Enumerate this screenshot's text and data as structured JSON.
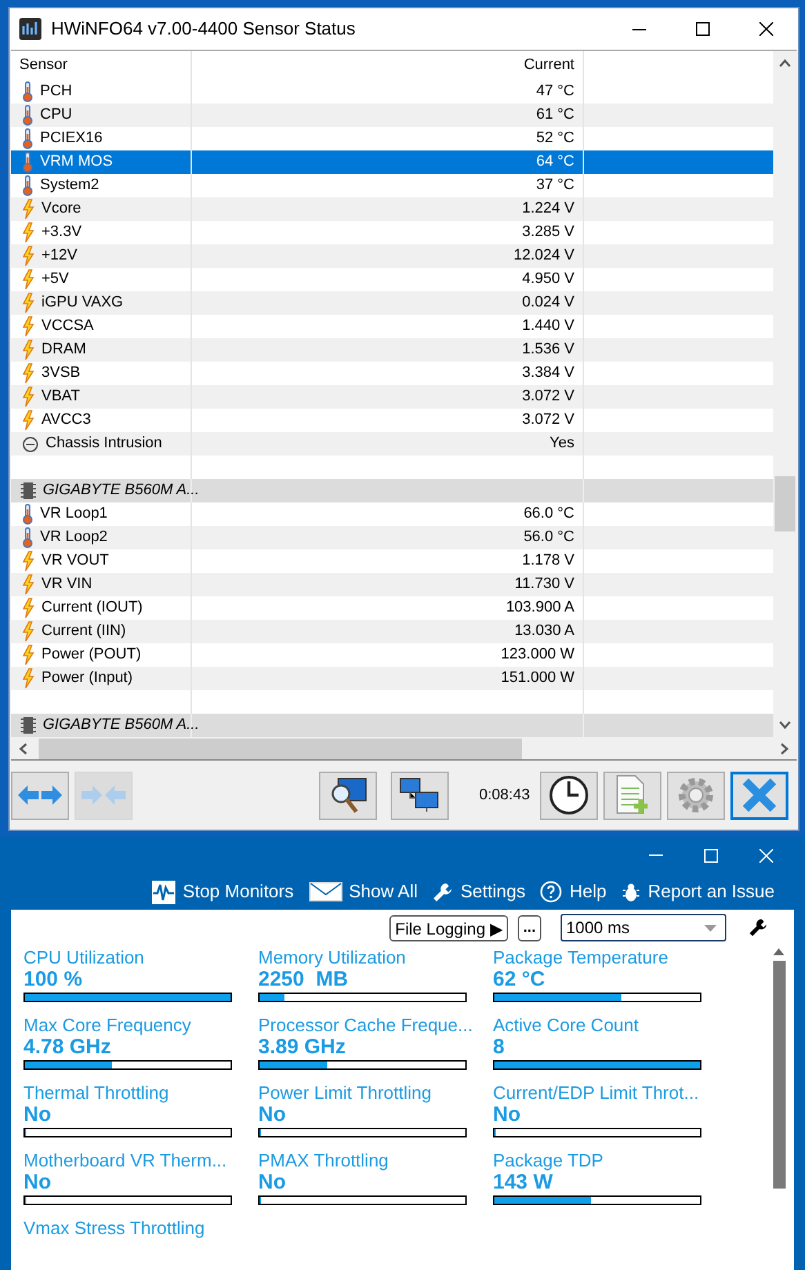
{
  "sensor_window": {
    "title": "HWiNFO64 v7.00-4400 Sensor Status",
    "table": {
      "columns": [
        "Sensor",
        "Current"
      ],
      "rows": [
        {
          "kind": "temp",
          "name": "PCH",
          "current": "47 °C",
          "selected": false
        },
        {
          "kind": "temp",
          "name": "CPU",
          "current": "61 °C",
          "selected": false
        },
        {
          "kind": "temp",
          "name": "PCIEX16",
          "current": "52 °C",
          "selected": false
        },
        {
          "kind": "temp",
          "name": "VRM MOS",
          "current": "64 °C",
          "selected": true
        },
        {
          "kind": "temp",
          "name": "System2",
          "current": "37 °C",
          "selected": false
        },
        {
          "kind": "volt",
          "name": "Vcore",
          "current": "1.224 V",
          "selected": false
        },
        {
          "kind": "volt",
          "name": "+3.3V",
          "current": "3.285 V",
          "selected": false
        },
        {
          "kind": "volt",
          "name": "+12V",
          "current": "12.024 V",
          "selected": false
        },
        {
          "kind": "volt",
          "name": "+5V",
          "current": "4.950 V",
          "selected": false
        },
        {
          "kind": "volt",
          "name": "iGPU VAXG",
          "current": "0.024 V",
          "selected": false
        },
        {
          "kind": "volt",
          "name": "VCCSA",
          "current": "1.440 V",
          "selected": false
        },
        {
          "kind": "volt",
          "name": "DRAM",
          "current": "1.536 V",
          "selected": false
        },
        {
          "kind": "volt",
          "name": "3VSB",
          "current": "3.384 V",
          "selected": false
        },
        {
          "kind": "volt",
          "name": "VBAT",
          "current": "3.072 V",
          "selected": false
        },
        {
          "kind": "volt",
          "name": "AVCC3",
          "current": "3.072 V",
          "selected": false
        },
        {
          "kind": "other",
          "name": "Chassis Intrusion",
          "current": "Yes",
          "selected": false
        },
        {
          "kind": "spacer"
        },
        {
          "kind": "group",
          "name": "GIGABYTE B560M A..."
        },
        {
          "kind": "temp",
          "name": "VR Loop1",
          "current": "66.0 °C",
          "selected": false
        },
        {
          "kind": "temp",
          "name": "VR Loop2",
          "current": "56.0 °C",
          "selected": false
        },
        {
          "kind": "volt",
          "name": "VR VOUT",
          "current": "1.178 V",
          "selected": false
        },
        {
          "kind": "volt",
          "name": "VR VIN",
          "current": "11.730 V",
          "selected": false
        },
        {
          "kind": "volt",
          "name": "Current (IOUT)",
          "current": "103.900 A",
          "selected": false
        },
        {
          "kind": "volt",
          "name": "Current (IIN)",
          "current": "13.030 A",
          "selected": false
        },
        {
          "kind": "volt",
          "name": "Power (POUT)",
          "current": "123.000 W",
          "selected": false
        },
        {
          "kind": "volt",
          "name": "Power (Input)",
          "current": "151.000 W",
          "selected": false
        },
        {
          "kind": "spacer"
        },
        {
          "kind": "group",
          "name": "GIGABYTE B560M A..."
        }
      ]
    },
    "toolbar": {
      "elapsed": "0:08:43",
      "collapse_disabled": true
    }
  },
  "monitor_window": {
    "menu": [
      {
        "kind": "wave",
        "label": "Stop Monitors"
      },
      {
        "kind": "envelope",
        "label": "Show All"
      },
      {
        "kind": "wrench",
        "label": "Settings"
      },
      {
        "kind": "help",
        "label": "Help"
      },
      {
        "kind": "bug",
        "label": "Report an Issue"
      }
    ],
    "file_logging": "File Logging ▶",
    "more": "...",
    "interval": "1000 ms",
    "metrics": [
      {
        "label": "CPU Utilization",
        "value": "100 %",
        "level": 1.0
      },
      {
        "label": "Memory Utilization",
        "value": "2250  MB",
        "level": 0.12
      },
      {
        "label": "Package Temperature",
        "value": "62 °C",
        "level": 0.62
      },
      {
        "label": "Max Core Frequency",
        "value": "4.78 GHz",
        "level": 0.42
      },
      {
        "label": "Processor Cache Freque...",
        "value": "3.89 GHz",
        "level": 0.33
      },
      {
        "label": "Active Core Count",
        "value": "8",
        "level": 1.0
      },
      {
        "label": "Thermal Throttling",
        "value": "No",
        "level": 0
      },
      {
        "label": "Power Limit Throttling",
        "value": "No",
        "level": 0
      },
      {
        "label": "Current/EDP Limit Throt...",
        "value": "No",
        "level": 0
      },
      {
        "label": "Motherboard VR Therm...",
        "value": "No",
        "level": 0
      },
      {
        "label": "PMAX Throttling",
        "value": "No",
        "level": 0
      },
      {
        "label": "Package TDP",
        "value": "143 W",
        "level": 0.47
      },
      {
        "label": "Vmax Stress Throttling"
      }
    ]
  }
}
